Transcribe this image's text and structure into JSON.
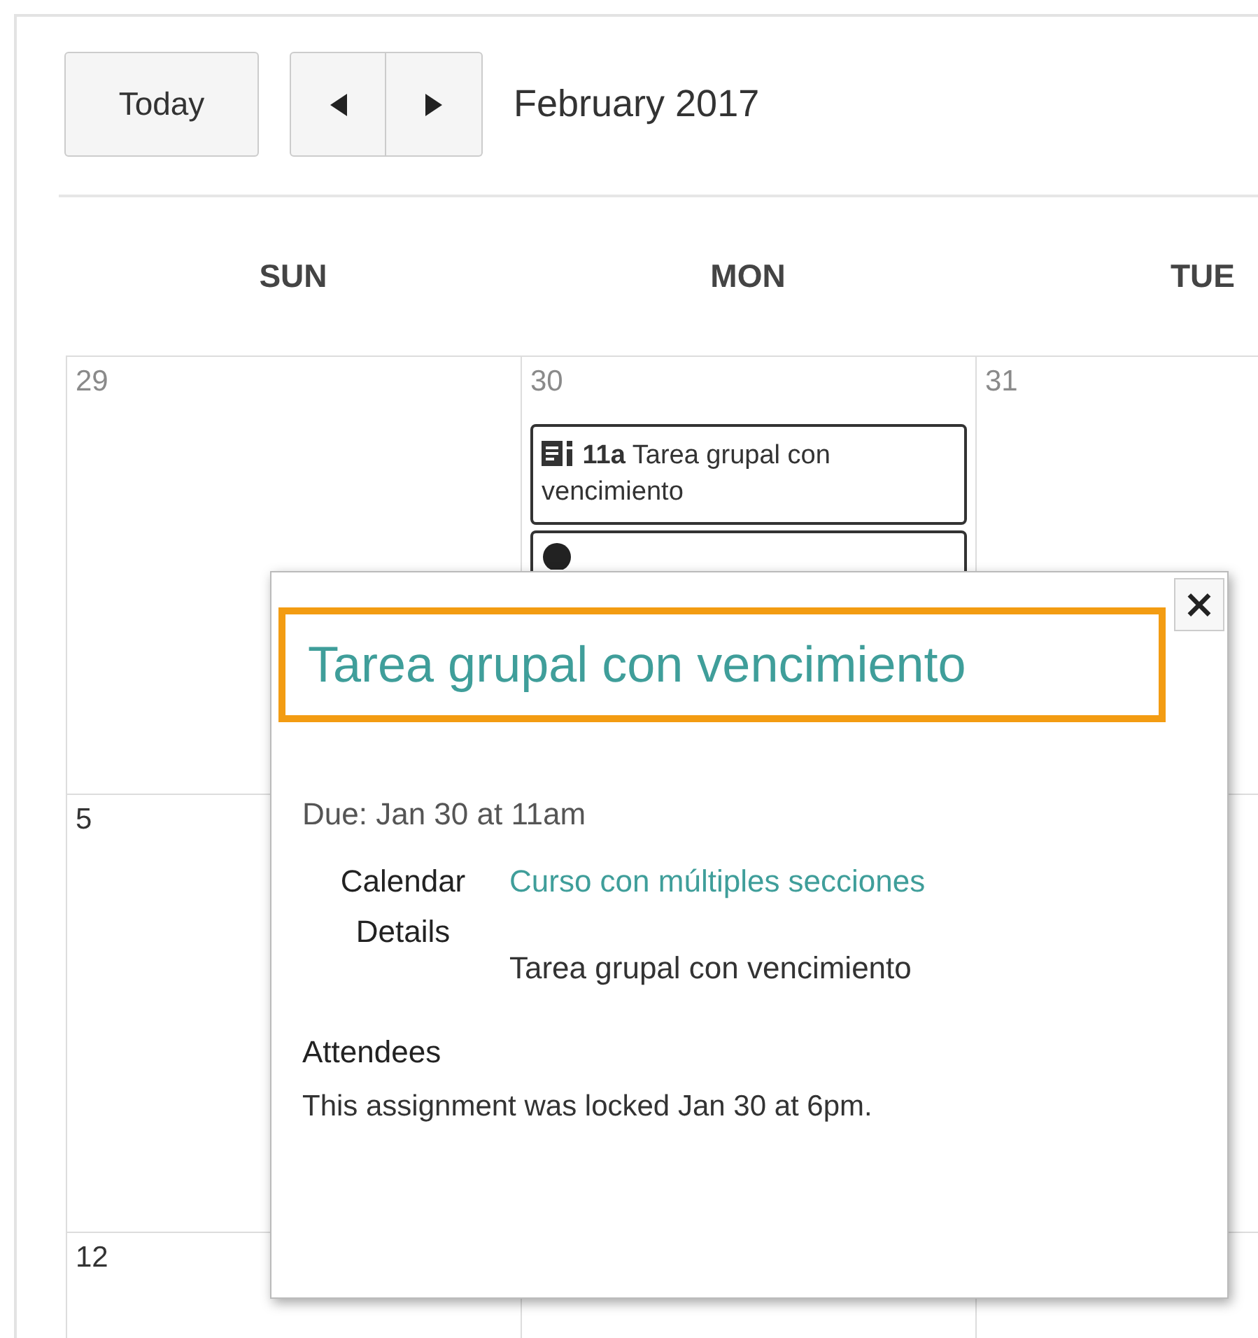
{
  "toolbar": {
    "today_button": "Today",
    "month_title": "February 2017"
  },
  "weekdays": [
    "SUN",
    "MON",
    "TUE"
  ],
  "weeks": [
    {
      "days": [
        {
          "number": "29",
          "outside_month": true
        },
        {
          "number": "30",
          "outside_month": true,
          "events": [
            {
              "kind": "assignment",
              "time": "11a",
              "title": "Tarea grupal con vencimiento"
            },
            {
              "kind": "event"
            }
          ]
        },
        {
          "number": "31",
          "outside_month": true
        }
      ]
    },
    {
      "days": [
        {
          "number": "5",
          "outside_month": false
        }
      ]
    },
    {
      "days": [
        {
          "number": "12",
          "outside_month": false
        }
      ]
    }
  ],
  "popover": {
    "close": "×",
    "title": "Tarea grupal con vencimiento",
    "highlighted": true,
    "due": "Due: Jan 30 at 11am",
    "fields": [
      {
        "label": "Calendar",
        "value": "Curso con múltiples secciones",
        "kind": "link"
      },
      {
        "label": "Details",
        "value": "Tarea grupal con vencimiento",
        "kind": "text"
      }
    ],
    "attendees_heading": "Attendees",
    "note": "This assignment was locked Jan 30 at 6pm."
  }
}
